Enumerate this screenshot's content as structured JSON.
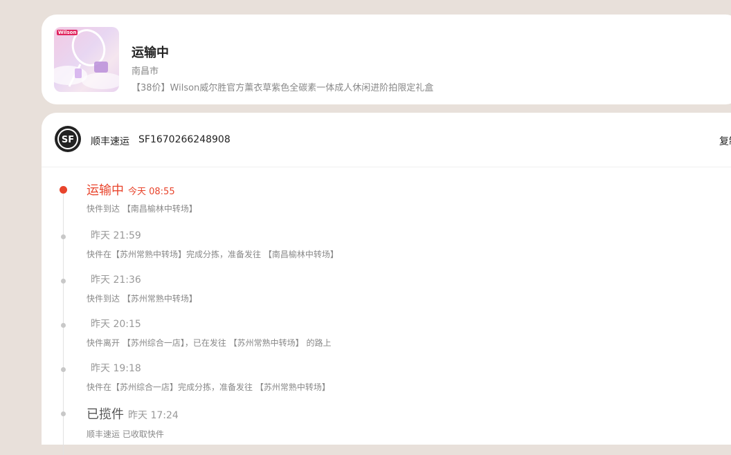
{
  "product": {
    "status": "运输中",
    "city": "南昌市",
    "name": "【38价】Wilson威尔胜官方薰衣草紫色全碳素一体成人休闲进阶拍限定礼盒",
    "thumb_logo_text": "Wilson"
  },
  "carrier": {
    "name": "顺丰速运",
    "tracking_number": "SF1670266248908",
    "copy_label": "复制",
    "logo_text": "SF"
  },
  "timeline": [
    {
      "status": "运输中",
      "time": "今天 08:55",
      "desc": "快件到达 【南昌榆林中转场】"
    },
    {
      "status": "",
      "time": "昨天 21:59",
      "desc": "快件在【苏州常熟中转场】完成分拣，准备发往 【南昌榆林中转场】"
    },
    {
      "status": "",
      "time": "昨天 21:36",
      "desc": "快件到达 【苏州常熟中转场】"
    },
    {
      "status": "",
      "time": "昨天 20:15",
      "desc": "快件离开 【苏州综合一店】，已在发往 【苏州常熟中转场】 的路上"
    },
    {
      "status": "",
      "time": "昨天 19:18",
      "desc": "快件在【苏州综合一店】完成分拣，准备发往 【苏州常熟中转场】"
    },
    {
      "status": "已揽件",
      "time": "昨天 17:24",
      "desc": "顺丰速运 已收取快件"
    }
  ],
  "colors": {
    "accent": "#e8442c",
    "background": "#e8e0da"
  }
}
